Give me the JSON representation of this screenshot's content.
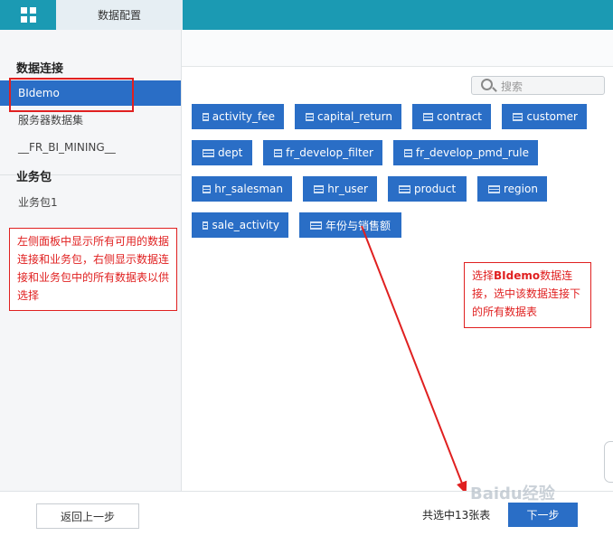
{
  "header": {
    "tab_label": "数据配置"
  },
  "search": {
    "placeholder": "搜索"
  },
  "left": {
    "connections_title": "数据连接",
    "connections": [
      "BIdemo",
      "服务器数据集",
      "__FR_BI_MINING__"
    ],
    "packages_title": "业务包",
    "packages": [
      "业务包1"
    ]
  },
  "tables": [
    "activity_fee",
    "capital_return",
    "contract",
    "customer",
    "dept",
    "fr_develop_filter",
    "fr_develop_pmd_rule",
    "hr_salesman",
    "hr_user",
    "product",
    "region",
    "sale_activity",
    "年份与销售额"
  ],
  "annotations": {
    "left_note": "左侧面板中显示所有可用的数据连接和业务包，右侧显示数据连接和业务包中的所有数据表以供选择",
    "right_note_prefix": "选择",
    "right_note_bold": "BIdemo",
    "right_note_suffix": "数据连接，选中该数据连接下的所有数据表"
  },
  "footer": {
    "prev_label": "返回上一步",
    "count_text": "共选中13张表",
    "next_label": "下一步"
  },
  "watermark": "Baidu经验",
  "colors": {
    "accent": "#2a6ec6",
    "topbar": "#1b9ab3",
    "annotation": "#e02020"
  }
}
